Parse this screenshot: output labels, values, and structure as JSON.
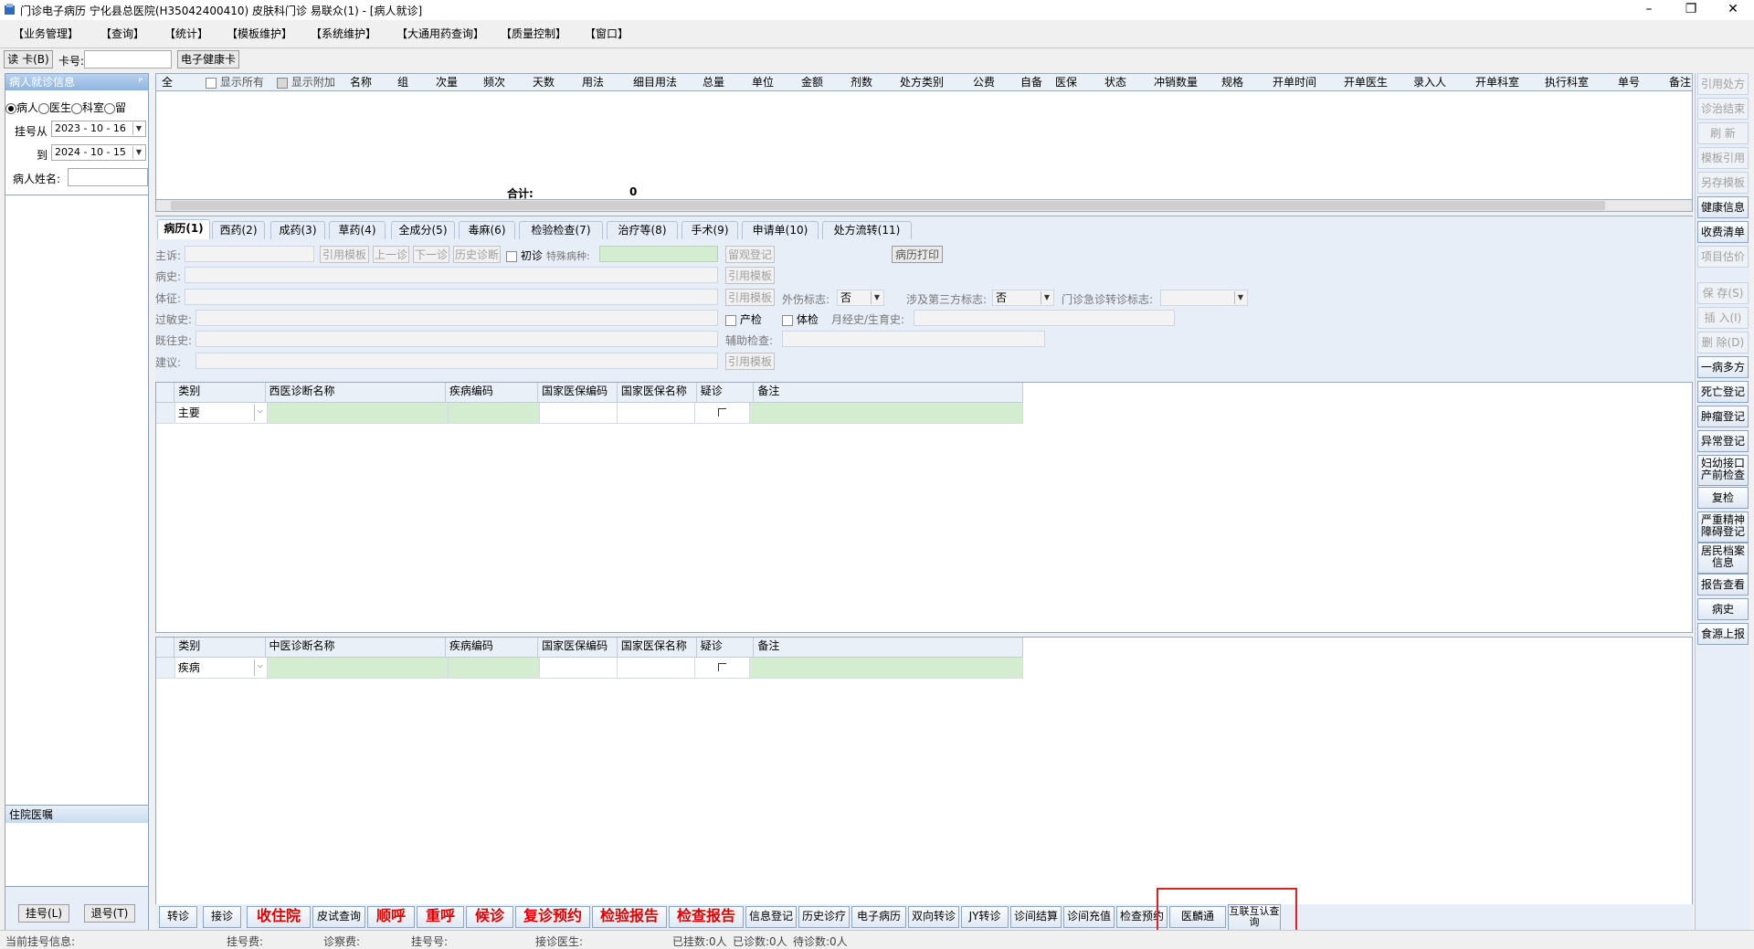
{
  "window": {
    "title": "门诊电子病历  宁化县总医院(H35042400410)  皮肤科门诊  易联众(1) - [病人就诊]",
    "minimize": "–",
    "restore": "❐",
    "close": "✕"
  },
  "menu": [
    "【业务管理】",
    "【查询】",
    "【统计】",
    "【模板维护】",
    "【系统维护】",
    "【大通用药查询】",
    "【质量控制】",
    "【窗口】"
  ],
  "toolbar": {
    "read_card": "读 卡(B)",
    "card_no_label": "卡号:",
    "card_no_value": "",
    "ehealth_card": "电子健康卡"
  },
  "left_panel": {
    "header": "病人就诊信息",
    "pin": "ᴾ",
    "radios": [
      "病人",
      "医生",
      "科室",
      "留"
    ],
    "reg_from_label": "挂号从",
    "reg_from": "2023 - 10 - 16",
    "reg_to_label": "到",
    "reg_to": "2024 - 10 - 15",
    "patient_name_label": "病人姓名:",
    "patient_name_value": "",
    "inpatient_header": "住院医嘱",
    "reg_button": "挂号(L)",
    "unreg_button": "退号(T)"
  },
  "rx_grid": {
    "show_all": "显示所有",
    "show_extra": "显示附加",
    "columns": [
      "全",
      "名称",
      "组",
      "次量",
      "频次",
      "天数",
      "用法",
      "细目用法",
      "总量",
      "单位",
      "金额",
      "剂数",
      "处方类别",
      "公费",
      "自备",
      "医保",
      "状态",
      "冲销数量",
      "规格",
      "开单时间",
      "开单医生",
      "录入人",
      "开单科室",
      "执行科室",
      "单号",
      "备注"
    ],
    "total_label": "合计:",
    "total_value": "0"
  },
  "tabs": [
    "病历(1)",
    "西药(2)",
    "成药(3)",
    "草药(4)",
    "全成分(5)",
    "毒麻(6)",
    "检验检查(7)",
    "治疗等(8)",
    "手术(9)",
    "申请单(10)",
    "处方流转(11)"
  ],
  "record": {
    "chief_complaint": "主诉:",
    "btn_ref_template": "引用模板",
    "btn_prev": "上一诊",
    "btn_next": "下一诊",
    "btn_history_dx": "历史诊断",
    "first_visit": "初诊",
    "special_disease": "特殊病种:",
    "btn_obs_register": "留观登记",
    "btn_print_record": "病历打印",
    "history": "病史:",
    "exam": "体征:",
    "injury_flag_label": "外伤标志:",
    "injury_flag": "否",
    "third_party_label": "涉及第三方标志:",
    "third_party": "否",
    "er_transfer_label": "门诊急诊转诊标志:",
    "er_transfer": "",
    "allergy": "过敏史:",
    "prenatal": "产检",
    "physical": "体检",
    "menstrual": "月经史/生育史:",
    "past_history": "既往史:",
    "aux_exam": "辅助检查:",
    "advice": "建议:"
  },
  "west_dx": {
    "columns": [
      "类别",
      "西医诊断名称",
      "疾病编码",
      "国家医保编码",
      "国家医保名称",
      "疑诊",
      "备注"
    ],
    "row": {
      "type": "主要",
      "name": "",
      "code": "",
      "nhsa_code": "",
      "nhsa_name": "",
      "remark": ""
    }
  },
  "tcm_dx": {
    "columns": [
      "类别",
      "中医诊断名称",
      "疾病编码",
      "国家医保编码",
      "国家医保名称",
      "疑诊",
      "备注"
    ],
    "row": {
      "type": "疾病",
      "name": "",
      "code": "",
      "nhsa_code": "",
      "nhsa_name": "",
      "remark": ""
    }
  },
  "right_buttons": [
    "引用处方",
    "诊治结束",
    "刷 新",
    "模板引用",
    "另存模板",
    "健康信息",
    "收费清单",
    "项目估价",
    "保 存(S)",
    "插 入(I)",
    "删 除(D)",
    "一病多方",
    "死亡登记",
    "肿瘤登记",
    "异常登记",
    "妇幼接口产前检查",
    "复检",
    "严重精神障碍登记",
    "居民档案信息",
    "报告查看",
    "病史",
    "食源上报"
  ],
  "bottom_buttons": [
    "转诊",
    "接诊",
    "收住院",
    "皮试查询",
    "顺呼",
    "重呼",
    "候诊",
    "复诊预约",
    "检验报告",
    "检查报告",
    "信息登记",
    "历史诊疗",
    "电子病历",
    "双向转诊",
    "JY转诊",
    "诊间结算",
    "诊间充值",
    "检查预约",
    "医麟通",
    "互联互认查询"
  ],
  "status_bar": {
    "current_reg": "当前挂号信息:",
    "reg_fee": "挂号费:",
    "consult_fee": "诊察费:",
    "reg_no": "挂号号:",
    "doctor": "接诊医生:",
    "registered": "已挂数:0人",
    "seen": "已诊数:0人",
    "waiting": "待诊数:0人"
  },
  "colors": {
    "accent_red": "#e00000",
    "highlight_box": "#e02020",
    "panel_blue": "#8db4e0"
  }
}
